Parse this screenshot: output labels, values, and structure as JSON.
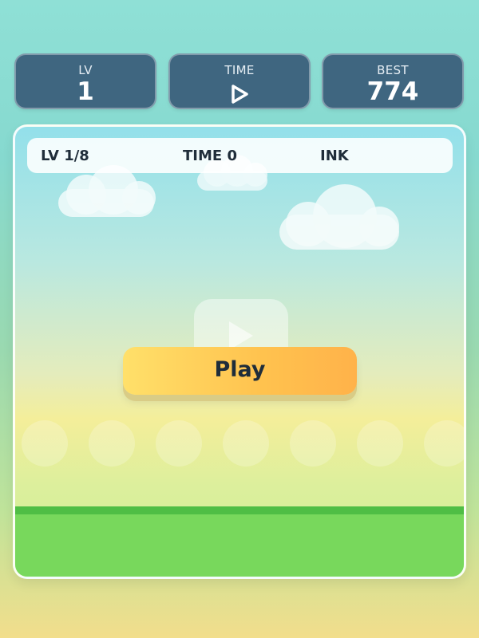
{
  "stats": {
    "level": {
      "label": "LV",
      "value": "1"
    },
    "time": {
      "label": "TIME",
      "icon": "play-icon"
    },
    "best": {
      "label": "BEST",
      "value": "774"
    }
  },
  "hud": {
    "level": "LV 1/8",
    "time": "TIME 0",
    "ink": "INK"
  },
  "play_button": {
    "label": "Play"
  },
  "colors": {
    "panel": "#3f6680",
    "button": "#ffc24e",
    "grass": "#78d85c",
    "grass_edge": "#4fbe45",
    "text_dark": "#1f2d3a"
  }
}
